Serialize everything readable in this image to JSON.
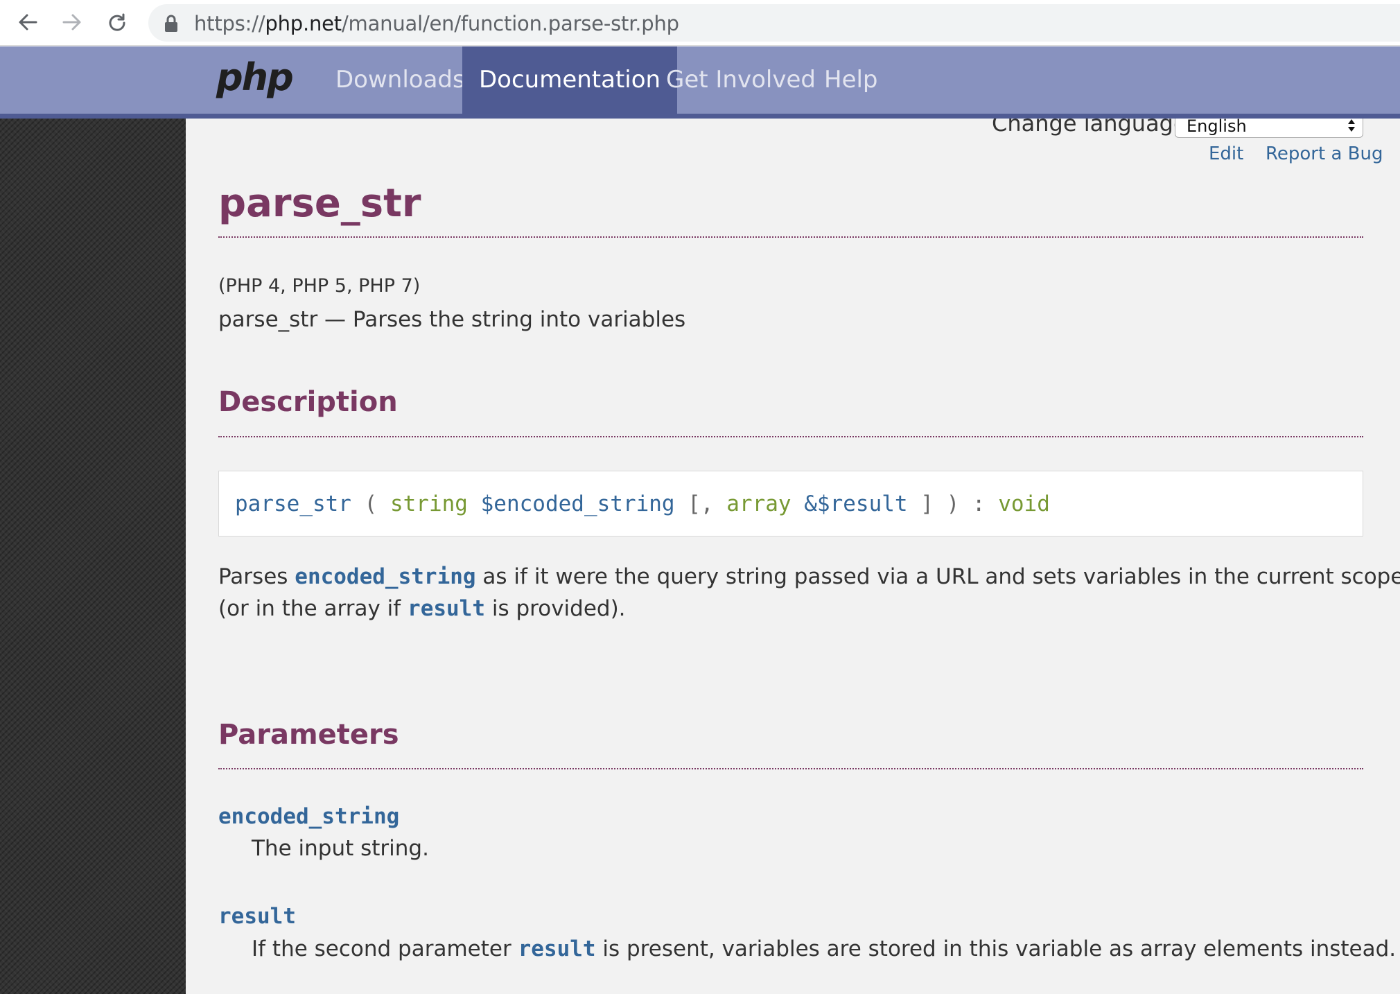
{
  "browser": {
    "url_prefix": "https://",
    "url_host": "php.net",
    "url_path": "/manual/en/function.parse-str.php"
  },
  "nav": {
    "logo": "php",
    "items": [
      {
        "label": "Downloads"
      },
      {
        "label": "Documentation",
        "active": true
      },
      {
        "label": "Get Involved"
      },
      {
        "label": "Help"
      }
    ]
  },
  "toolbar": {
    "change_language_label": "Change language:",
    "language_selected": "English",
    "edit_label": "Edit",
    "report_bug_label": "Report a Bug"
  },
  "page": {
    "title": "parse_str",
    "versions": "(PHP 4, PHP 5, PHP 7)",
    "refpurpose": "parse_str — Parses the string into variables"
  },
  "description": {
    "heading": "Description",
    "synopsis": {
      "function": "parse_str",
      "open_paren": " ( ",
      "type1": "string",
      "param1": "$encoded_string",
      "bracket_open": " [, ",
      "type2": "array",
      "param2": "&$result",
      "close": " ] ) : ",
      "return_type": "void"
    },
    "para_line1_start": "Parses ",
    "para_line1_param": "encoded_string",
    "para_line1_end": " as if it were the query string passed via a URL and sets variables in the current scope",
    "para_line2_start": "(or in the array if ",
    "para_line2_param": "result",
    "para_line2_end": " is provided)."
  },
  "parameters": {
    "heading": "Parameters",
    "items": [
      {
        "name": "encoded_string",
        "desc": "The input string."
      },
      {
        "name": "result",
        "desc_start": "If the second parameter ",
        "desc_param": "result",
        "desc_end": " is present, variables are stored in this variable as array elements instead."
      }
    ]
  },
  "colors": {
    "nav_bg": "#8892bf",
    "nav_active": "#4f5b93",
    "heading": "#793862",
    "link": "#336699",
    "type": "#779933"
  }
}
